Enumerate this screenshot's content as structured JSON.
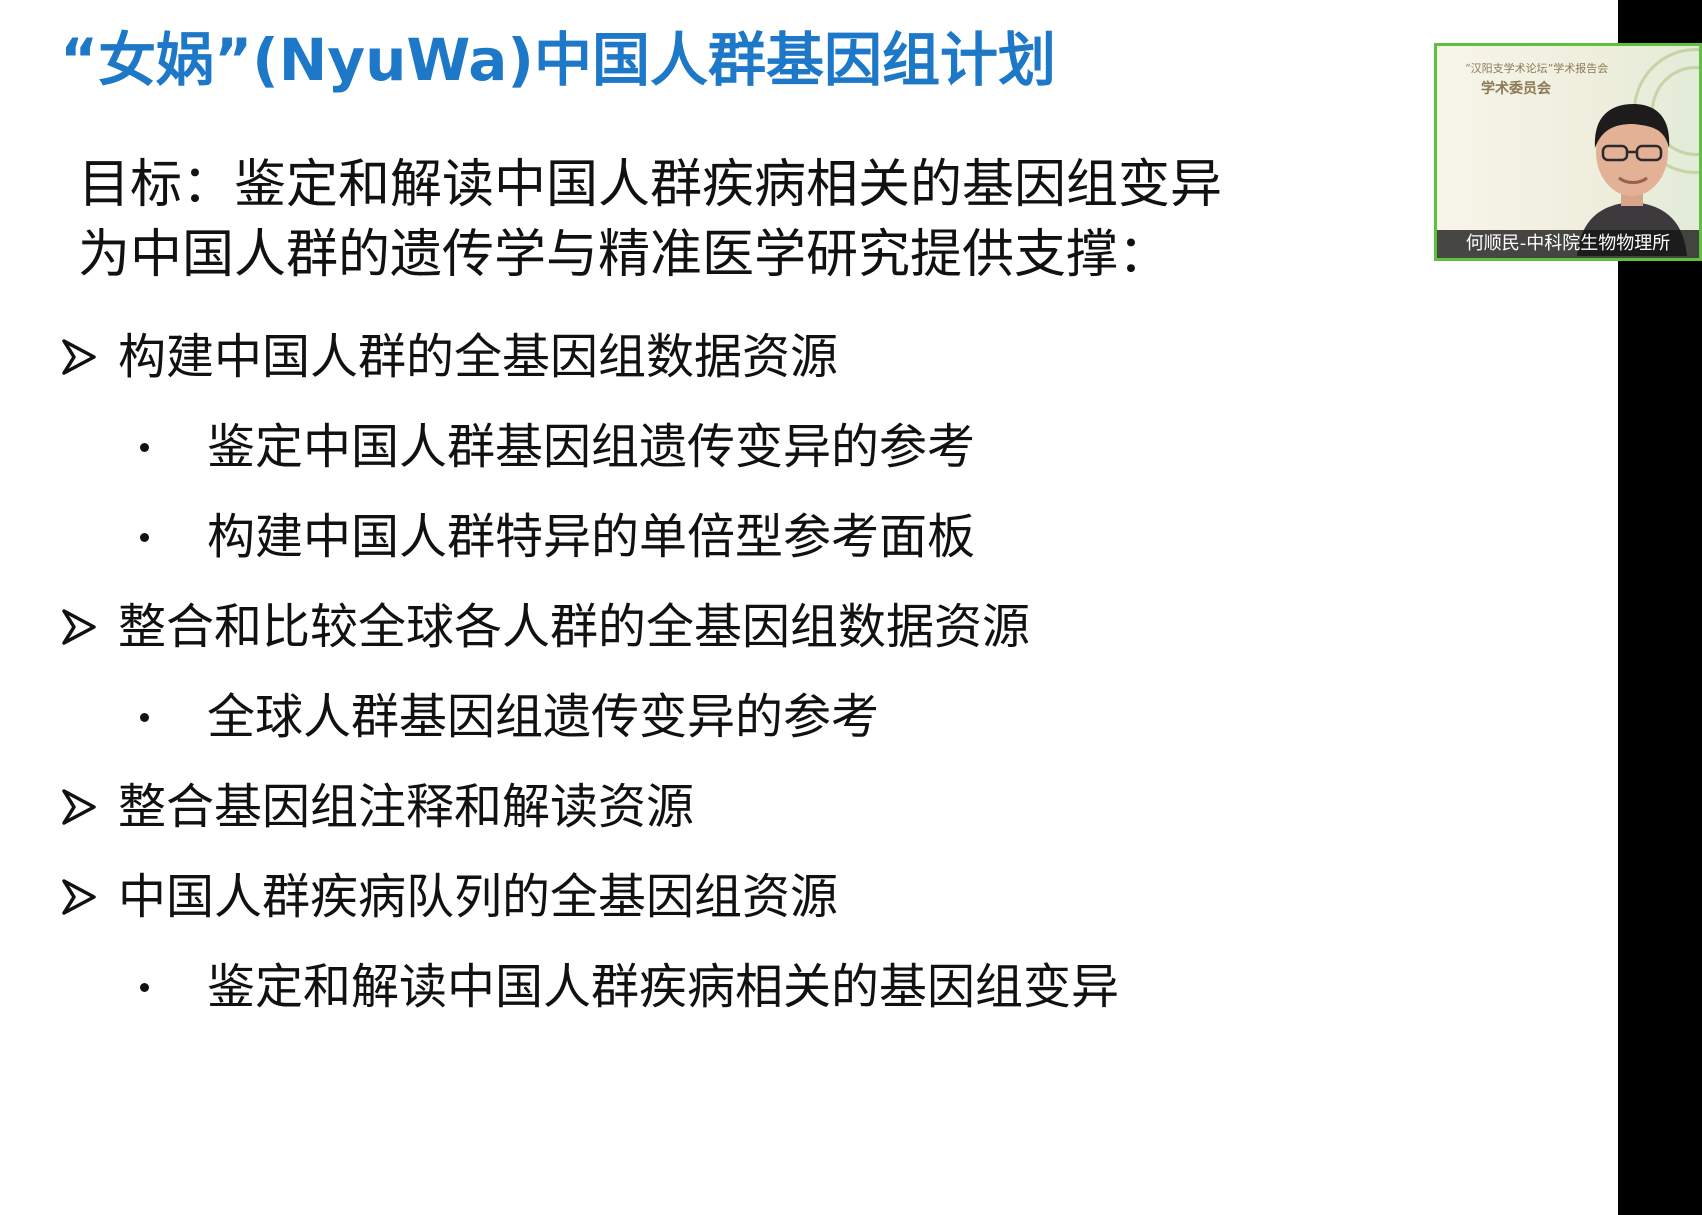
{
  "slide": {
    "title": "“女娲”(NyuWa)中国人群基因组计划",
    "goal_lines": [
      "目标：鉴定和解读中国人群疾病相关的基因组变异",
      "为中国人群的遗传学与精准医学研究提供支撑："
    ],
    "items": [
      {
        "level": 1,
        "text": "构建中国人群的全基因组数据资源"
      },
      {
        "level": 2,
        "text": "鉴定中国人群基因组遗传变异的参考"
      },
      {
        "level": 2,
        "text": "构建中国人群特异的单倍型参考面板"
      },
      {
        "level": 1,
        "text": "整合和比较全球各人群的全基因组数据资源"
      },
      {
        "level": 2,
        "text": "全球人群基因组遗传变异的参考"
      },
      {
        "level": 1,
        "text": "整合基因组注释和解读资源"
      },
      {
        "level": 1,
        "text": "中国人群疾病队列的全基因组资源"
      },
      {
        "level": 2,
        "text": "鉴定和解读中国人群疾病相关的基因组变异"
      }
    ]
  },
  "video": {
    "speaker_name": "何顺民-中科院生物物理所",
    "border_color": "#5fc03c",
    "backdrop_lines": [
      "“汉阳支学术论坛”学术报告会",
      "学术委员会"
    ]
  },
  "colors": {
    "title": "#1e78c8",
    "body_text": "#111111",
    "right_bar": "#000000"
  },
  "icons": {
    "level1_bullet": "arrow-bullet-icon",
    "level2_bullet": "dot-bullet-icon"
  }
}
